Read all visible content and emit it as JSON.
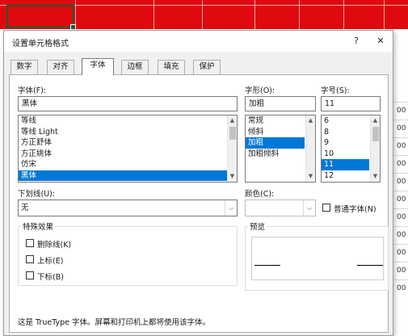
{
  "dialog": {
    "title": "设置单元格格式",
    "help_label": "?",
    "close_label": "✕"
  },
  "tabs": [
    {
      "label": "数字"
    },
    {
      "label": "对齐"
    },
    {
      "label": "字体"
    },
    {
      "label": "边框"
    },
    {
      "label": "填充"
    },
    {
      "label": "保护"
    }
  ],
  "active_tab": "字体",
  "font": {
    "label": "字体(F):",
    "value": "黑体",
    "options": [
      "等线",
      "等线 Light",
      "方正舒体",
      "方正姚体",
      "仿宋",
      "黑体"
    ],
    "selected": "黑体"
  },
  "style": {
    "label": "字形(O):",
    "value": "加粗",
    "options": [
      "常规",
      "倾斜",
      "加粗",
      "加粗倾斜"
    ],
    "selected": "加粗"
  },
  "size": {
    "label": "字号(S):",
    "value": "11",
    "options": [
      "6",
      "8",
      "9",
      "10",
      "11",
      "12"
    ],
    "selected": "11"
  },
  "underline": {
    "label": "下划线(U):",
    "value": "无"
  },
  "color": {
    "label": "颜色(C):",
    "value": ""
  },
  "normal_font": {
    "label": "普通字体(N)",
    "checked": false
  },
  "effects": {
    "title": "特殊效果",
    "strikethrough": "删除线(K)",
    "superscript": "上标(E)",
    "subscript": "下标(B)"
  },
  "preview": {
    "title": "预览"
  },
  "info_text": "这是 TrueType 字体。屏幕和打印机上都将使用该字体。",
  "sheet": {
    "accent_color": "#e0090f",
    "row_numbers": [
      "00",
      "00",
      "00",
      "00",
      "00",
      "00",
      "00",
      "00",
      "00",
      "00",
      "00"
    ]
  }
}
